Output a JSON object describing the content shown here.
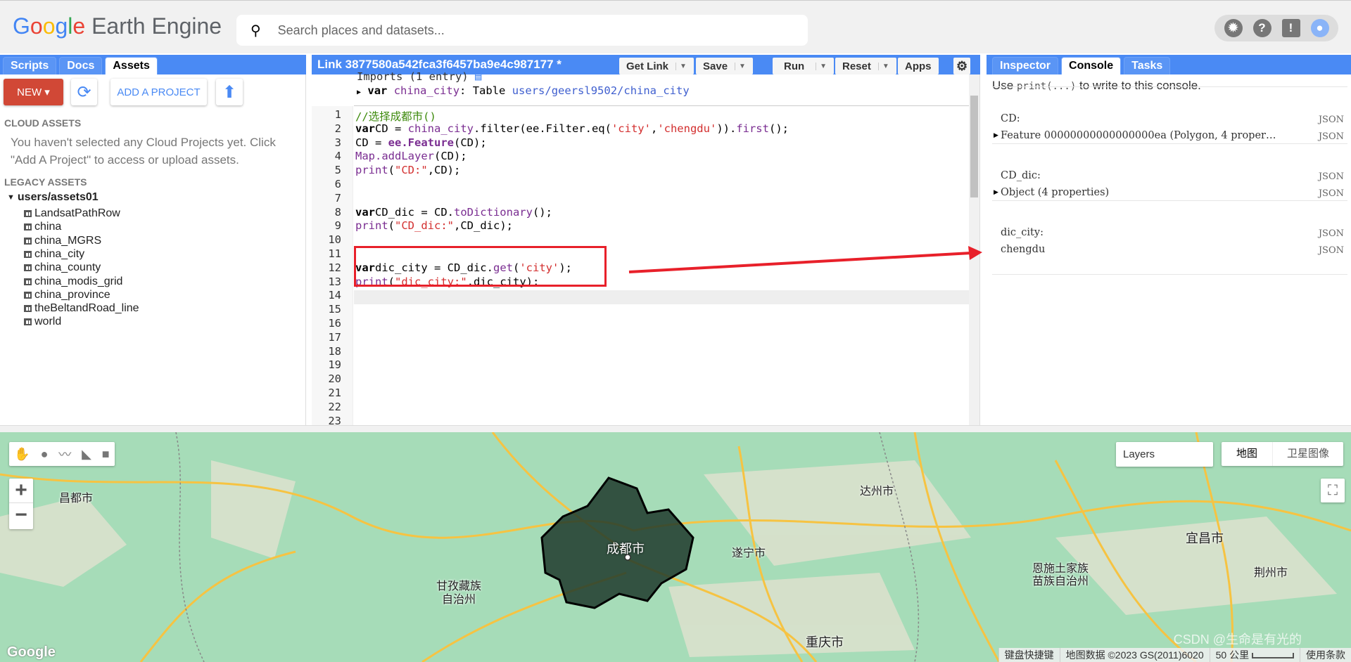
{
  "header": {
    "logo": "Google Earth Engine",
    "search_placeholder": "Search places and datasets...",
    "icons": [
      "brightness-icon",
      "help-icon",
      "feedback-icon",
      "account-icon"
    ]
  },
  "left_panel": {
    "tabs": [
      "Scripts",
      "Docs",
      "Assets"
    ],
    "active_tab": "Assets",
    "new_label": "NEW",
    "add_project_label": "ADD A PROJECT",
    "cloud_title": "CLOUD ASSETS",
    "cloud_msg_1": "You haven't selected any Cloud Projects yet. Click",
    "cloud_msg_2": "\"Add A Project\" to access or upload assets.",
    "legacy_title": "LEGACY ASSETS",
    "root": "users/assets01",
    "assets": [
      "LandsatPathRow",
      "china",
      "china_MGRS",
      "china_city",
      "china_county",
      "china_modis_grid",
      "china_province",
      "theBeltandRoad_line",
      "world"
    ]
  },
  "editor": {
    "title": "Link 3877580a542fca3f6457ba9e4c987177 *",
    "buttons": {
      "get_link": "Get Link",
      "save": "Save",
      "run": "Run",
      "reset": "Reset",
      "apps": "Apps"
    },
    "imports_header": "Imports (1 entry)",
    "import_var": "var",
    "import_name": "china_city",
    "import_type": ": Table",
    "import_path": "users/geersl9502/china_city",
    "lines": [
      [
        [
          "cm",
          "//选择成都市()"
        ]
      ],
      [
        [
          "kw",
          "var"
        ],
        [
          "",
          "CD = "
        ],
        [
          "vr",
          "china_city"
        ],
        [
          "",
          ".filter(ee.Filter.eq("
        ],
        [
          "str",
          "'city'"
        ],
        [
          "",
          ","
        ],
        [
          "str",
          "'chengdu'"
        ],
        [
          "",
          "))."
        ],
        [
          "fn",
          "first"
        ],
        [
          "",
          "();"
        ]
      ],
      [
        [
          "",
          "CD = "
        ],
        [
          "vr kw",
          "ee.Feature"
        ],
        [
          "",
          "(CD);"
        ]
      ],
      [
        [
          "fn",
          "Map.addLayer"
        ],
        [
          "",
          "(CD);"
        ]
      ],
      [
        [
          "fn",
          "print"
        ],
        [
          "",
          "("
        ],
        [
          "str",
          "\"CD:\""
        ],
        [
          "",
          ",CD);"
        ]
      ],
      [],
      [],
      [
        [
          "kw",
          "var"
        ],
        [
          "",
          "CD_dic = CD."
        ],
        [
          "fn",
          "toDictionary"
        ],
        [
          "",
          "();"
        ]
      ],
      [
        [
          "fn",
          "print"
        ],
        [
          "",
          "("
        ],
        [
          "str",
          "\"CD_dic:\""
        ],
        [
          "",
          ",CD_dic);"
        ]
      ],
      [],
      [],
      [
        [
          "kw",
          "var"
        ],
        [
          "",
          "dic_city = CD_dic."
        ],
        [
          "fn",
          "get"
        ],
        [
          "",
          "("
        ],
        [
          "str",
          "'city'"
        ],
        [
          "",
          ");"
        ]
      ],
      [
        [
          "fn",
          "print"
        ],
        [
          "",
          "("
        ],
        [
          "str",
          "\"dic_city:\""
        ],
        [
          "",
          ",dic_city);"
        ]
      ],
      [],
      [],
      [],
      [],
      [],
      [],
      [],
      [],
      [],
      [],
      []
    ]
  },
  "right_panel": {
    "tabs": [
      "Inspector",
      "Console",
      "Tasks"
    ],
    "active_tab": "Console",
    "hint_pre": "Use ",
    "hint_code": "print(...)",
    "hint_post": " to write to this console.",
    "entries": [
      {
        "label": "CD:",
        "value": "Feature 00000000000000000ea (Polygon, 4 proper…",
        "json": "JSON"
      },
      {
        "label": "CD_dic:",
        "value": "Object (4 properties)",
        "json": "JSON"
      },
      {
        "label": "dic_city:",
        "value": "chengdu",
        "json": "JSON"
      }
    ]
  },
  "map": {
    "layers_label": "Layers",
    "map_type": "地图",
    "satellite": "卫星图像",
    "labels": [
      "昌都市",
      "达州市",
      "成都市",
      "遂宁市",
      "甘孜藏族",
      "自治州",
      "恩施土家族",
      "苗族自治州",
      "宜昌市",
      "荆州市",
      "重庆市"
    ],
    "attribution": {
      "shortcuts": "键盘快捷键",
      "data": "地图数据 ©2023 GS(2011)6020",
      "scale": "50 公里",
      "terms": "使用条款"
    },
    "google": "Google",
    "watermark": "CSDN @生命是有光的"
  },
  "colors": {
    "accent": "#4a8af4",
    "new_button": "#d14836",
    "highlight": "#e8202a",
    "polygon": "#1e3a2c"
  }
}
